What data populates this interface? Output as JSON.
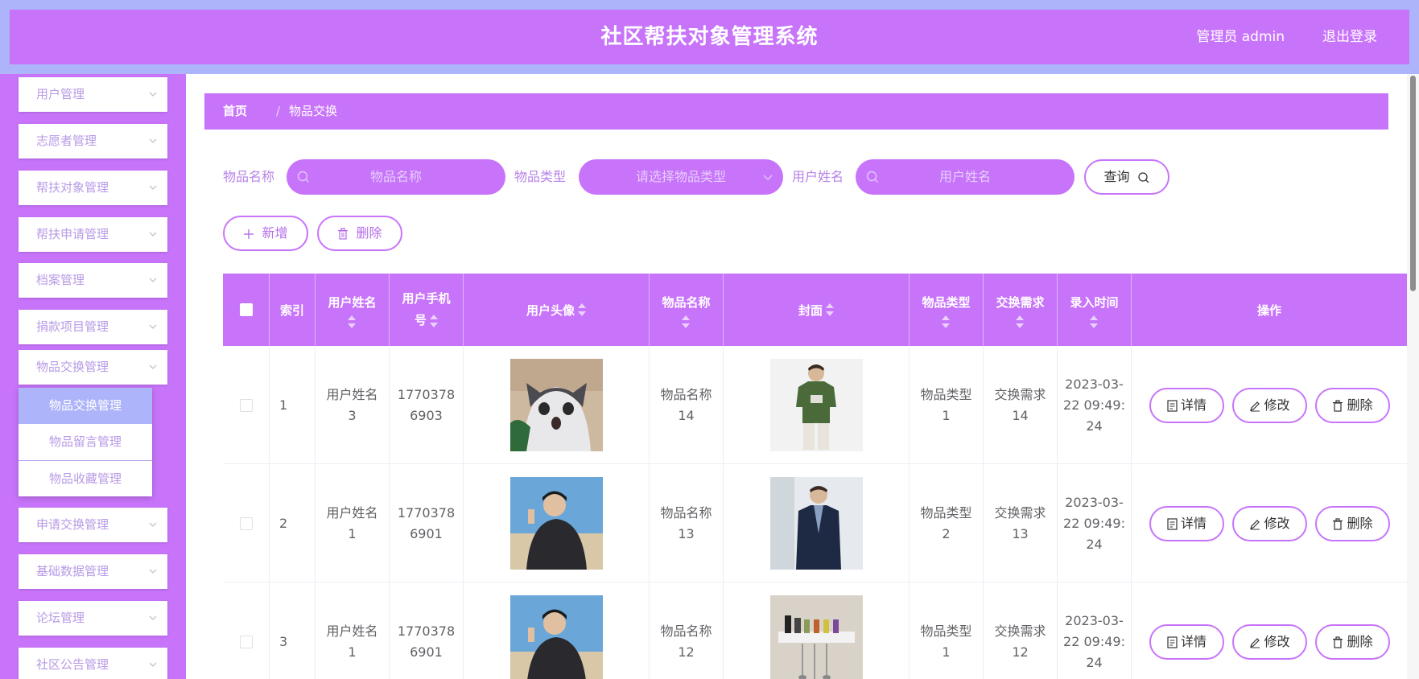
{
  "header": {
    "title": "社区帮扶对象管理系统",
    "user": "管理员 admin",
    "logout": "退出登录"
  },
  "sidebar": {
    "items": [
      {
        "label": "用户管理"
      },
      {
        "label": "志愿者管理"
      },
      {
        "label": "帮扶对象管理"
      },
      {
        "label": "帮扶申请管理"
      },
      {
        "label": "档案管理"
      },
      {
        "label": "捐款项目管理"
      },
      {
        "label": "物品交换管理"
      },
      {
        "label": "申请交换管理"
      },
      {
        "label": "基础数据管理"
      },
      {
        "label": "论坛管理"
      },
      {
        "label": "社区公告管理"
      }
    ],
    "submenu": [
      {
        "label": "物品交换管理",
        "active": true
      },
      {
        "label": "物品留言管理"
      },
      {
        "label": "物品收藏管理"
      }
    ]
  },
  "breadcrumb": {
    "home": "首页",
    "sep": "/",
    "current": "物品交换"
  },
  "filters": {
    "name_label": "物品名称",
    "name_placeholder": "物品名称",
    "type_label": "物品类型",
    "type_placeholder": "请选择物品类型",
    "user_label": "用户姓名",
    "user_placeholder": "用户姓名",
    "query": "查询"
  },
  "toolbar": {
    "add": "新增",
    "delete": "删除"
  },
  "table": {
    "headers": {
      "index": "索引",
      "username": "用户姓名",
      "phone_a": "用户手机",
      "phone_b": "号",
      "avatar": "用户头像",
      "item_name": "物品名称",
      "cover": "封面",
      "item_type": "物品类型",
      "exchange": "交换需求",
      "time": "录入时间",
      "actions": "操作"
    },
    "rows": [
      {
        "index": "1",
        "username_a": "用户姓名",
        "username_b": "3",
        "phone_a": "1770378",
        "phone_b": "6903",
        "item_a": "物品名称",
        "item_b": "14",
        "type_a": "物品类型",
        "type_b": "1",
        "ex_a": "交换需求",
        "ex_b": "14",
        "time_a": "2023-03-",
        "time_b": "22 09:49:",
        "time_c": "24",
        "avatar": "cat",
        "cover": "green-tshirt"
      },
      {
        "index": "2",
        "username_a": "用户姓名",
        "username_b": "1",
        "phone_a": "1770378",
        "phone_b": "6901",
        "item_a": "物品名称",
        "item_b": "13",
        "type_a": "物品类型",
        "type_b": "2",
        "ex_a": "交换需求",
        "ex_b": "13",
        "time_a": "2023-03-",
        "time_b": "22 09:49:",
        "time_c": "24",
        "avatar": "man-beach",
        "cover": "navy-jacket"
      },
      {
        "index": "3",
        "username_a": "用户姓名",
        "username_b": "1",
        "phone_a": "1770378",
        "phone_b": "6901",
        "item_a": "物品名称",
        "item_b": "12",
        "type_a": "物品类型",
        "type_b": "1",
        "ex_a": "交换需求",
        "ex_b": "12",
        "time_a": "2023-03-",
        "time_b": "22 09:49:",
        "time_c": "24",
        "avatar": "man-beach",
        "cover": "kitchen-rack"
      }
    ],
    "actions": {
      "detail": "详情",
      "edit": "修改",
      "delete": "删除"
    }
  },
  "colors": {
    "primary": "#c874fa",
    "header_frame": "#aeb4f9",
    "submenu_active": "#aeb4f9"
  }
}
